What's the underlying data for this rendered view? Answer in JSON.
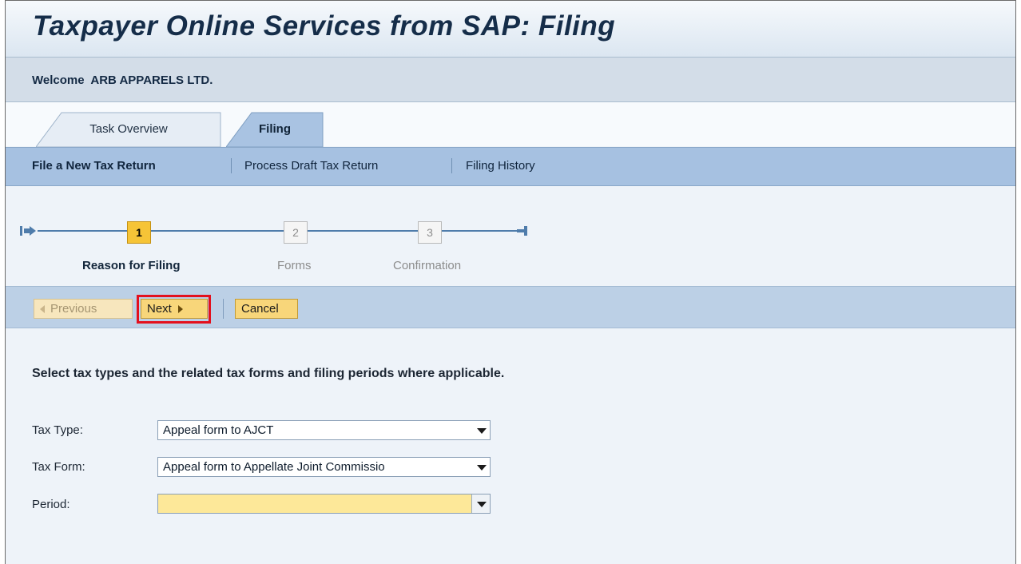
{
  "app": {
    "title": "Taxpayer Online Services from SAP: Filing"
  },
  "welcome": {
    "text": "Welcome  ARB APPARELS LTD."
  },
  "tabs": [
    {
      "label": "Task Overview",
      "selected": false
    },
    {
      "label": "Filing",
      "selected": true
    }
  ],
  "subnav": {
    "items": [
      {
        "label": "File a New Tax Return",
        "selected": true
      },
      {
        "label": "Process Draft Tax Return",
        "selected": false
      },
      {
        "label": "Filing History",
        "selected": false
      }
    ]
  },
  "roadmap": {
    "steps": [
      {
        "number": "1",
        "label": "Reason for Filing",
        "active": true
      },
      {
        "number": "2",
        "label": "Forms",
        "active": false
      },
      {
        "number": "3",
        "label": "Confirmation",
        "active": false
      }
    ]
  },
  "toolbar": {
    "previous_label": "Previous",
    "next_label": "Next",
    "cancel_label": "Cancel"
  },
  "instructions": "Select tax types and the related tax forms and filing periods where applicable.",
  "form": {
    "tax_type": {
      "label": "Tax Type:",
      "value": "Appeal form to AJCT"
    },
    "tax_form": {
      "label": "Tax Form:",
      "value": "Appeal form to Appellate Joint Commissio"
    },
    "period": {
      "label": "Period:",
      "value": ""
    }
  },
  "colors": {
    "accent_step": "#f6c437",
    "subnav_bar": "#a6c1e1",
    "highlight": "#e3101e",
    "period_field": "#fde899"
  }
}
